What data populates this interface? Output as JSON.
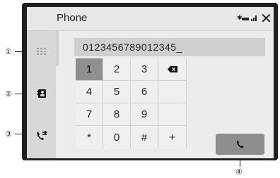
{
  "header": {
    "title": "Phone",
    "bluetooth_glyph": "✱",
    "close_glyph": "✕"
  },
  "display": {
    "number": "0123456789012345_"
  },
  "keypad": {
    "keys": [
      "1",
      "2",
      "3",
      "⌫",
      "4",
      "5",
      "6",
      "",
      "7",
      "8",
      "9",
      "",
      "*",
      "0",
      "#",
      "+"
    ]
  },
  "callouts": [
    "①",
    "②",
    "③",
    "④"
  ],
  "icons": [
    "dialpad-icon",
    "contacts-icon",
    "call-history-icon",
    "backspace-icon",
    "phone-icon",
    "bluetooth-icon",
    "battery-icon",
    "signal-icon",
    "close-icon"
  ]
}
